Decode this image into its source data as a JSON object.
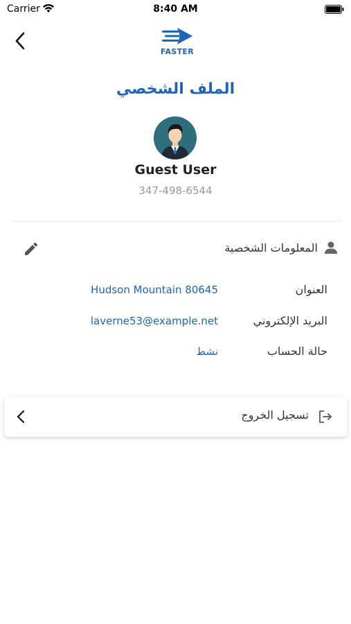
{
  "status_bar": {
    "carrier": "Carrier",
    "time": "8:40 AM"
  },
  "header": {
    "logo_text": "FASTER",
    "logo_color": "#1e64b7",
    "back_icon": "chevron-left-icon"
  },
  "page": {
    "title": "الملف الشخصي"
  },
  "profile": {
    "name": "Guest User",
    "phone": "347-498-6544"
  },
  "personal_info": {
    "section_title": "المعلومات الشخصية",
    "section_icon": "person-icon",
    "edit_icon": "pencil-icon",
    "rows": [
      {
        "label": "العنوان",
        "value": "Hudson Mountain 80645"
      },
      {
        "label": "البريد الإلكتروني",
        "value": "laverne53@example.net"
      },
      {
        "label": "حالة الحساب",
        "value": "نشط"
      }
    ]
  },
  "logout": {
    "label": "تسجيل الخروج",
    "icon": "logout-icon"
  },
  "colors": {
    "accent": "#1e64b7",
    "muted": "#999999"
  }
}
